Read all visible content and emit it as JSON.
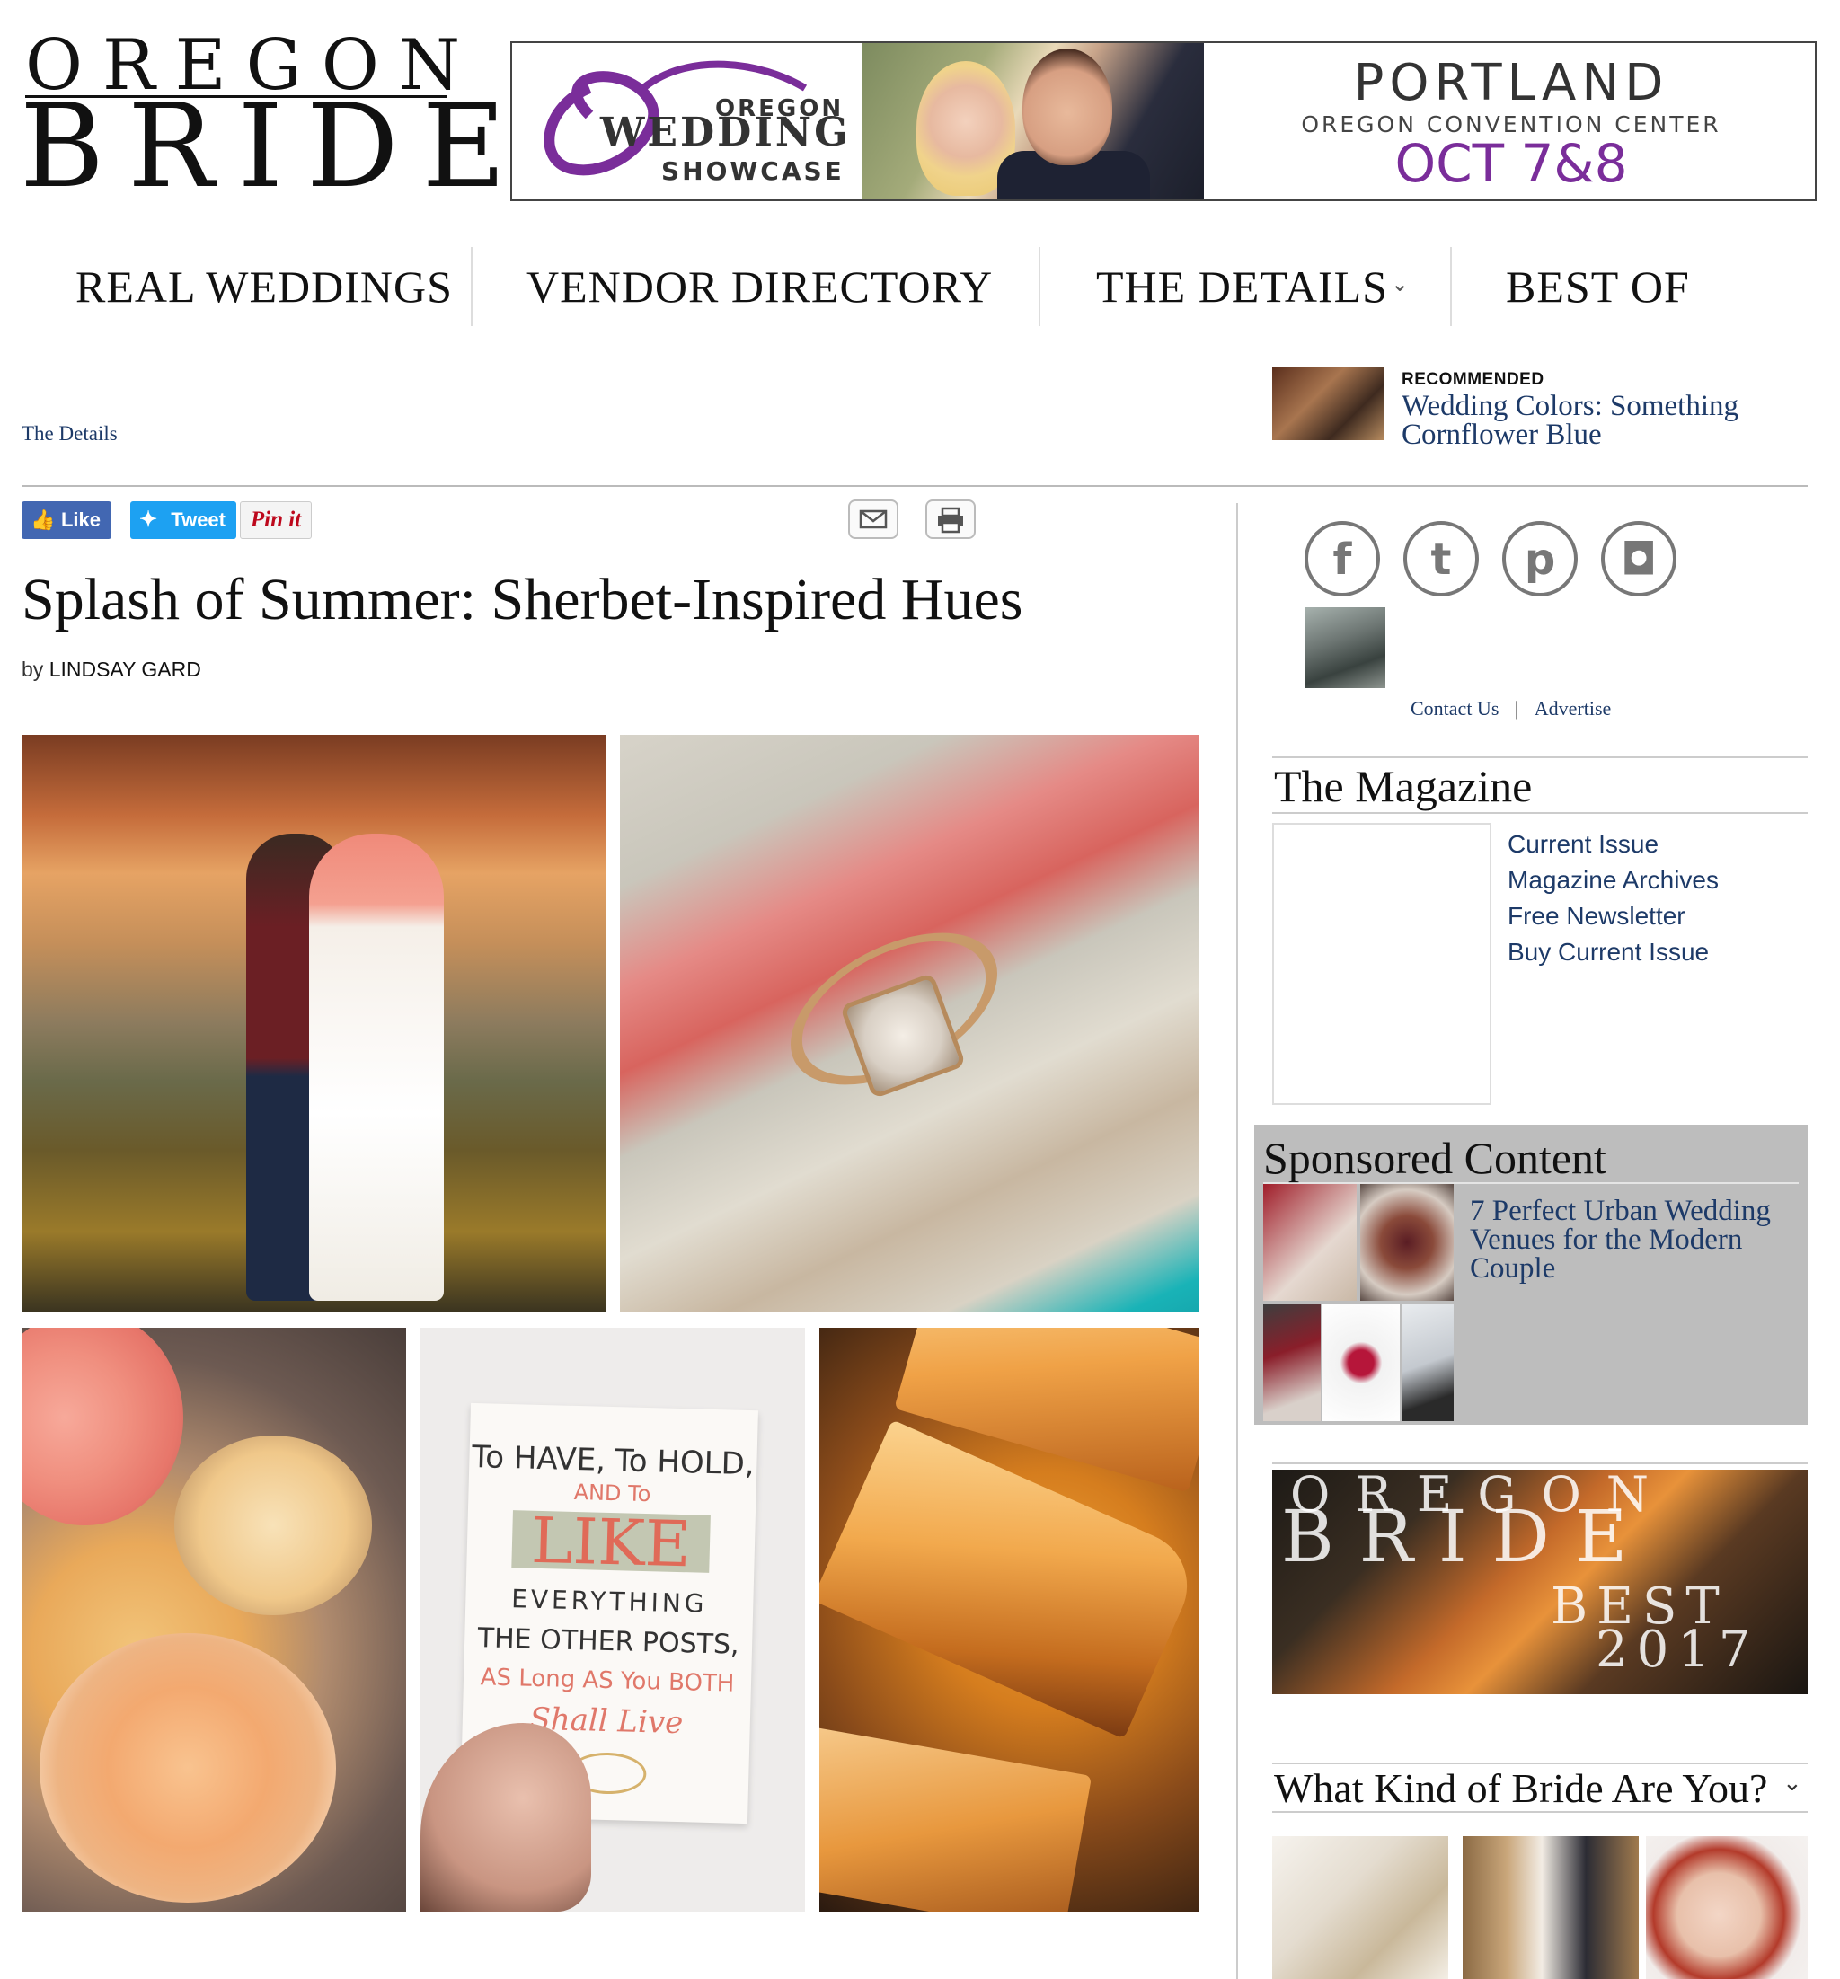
{
  "brand": {
    "logo_top": "OREGON",
    "logo_bottom": "BRIDE"
  },
  "banner": {
    "showcase_line1": "OREGON",
    "showcase_line2": "WEDDING",
    "showcase_line3": "SHOWCASE",
    "city": "PORTLAND",
    "venue": "OREGON CONVENTION CENTER",
    "date": "OCT 7&8",
    "accent": "#7a2d9a"
  },
  "nav": {
    "items": [
      {
        "label": "REAL WEDDINGS"
      },
      {
        "label": "VENDOR DIRECTORY"
      },
      {
        "label": "THE DETAILS",
        "dropdown_icon": "chevron-down-icon"
      },
      {
        "label": "BEST OF"
      }
    ]
  },
  "breadcrumb": {
    "label": "The Details"
  },
  "recommended": {
    "label": "RECOMMENDED",
    "title": "Wedding Colors: Something Cornflower Blue"
  },
  "share": {
    "like": "Like",
    "tweet": "Tweet",
    "pin": "Pin it",
    "email_icon": "envelope-icon",
    "print_icon": "printer-icon"
  },
  "article": {
    "title": "Splash of Summer: Sherbet-Inspired Hues",
    "byline_prefix": "by",
    "author": "LINDSAY GARD",
    "card_lines": [
      "To HAVE, To HOLD,",
      "AND To",
      "LIKE",
      "EVERYTHING",
      "THE OTHER POSTS,",
      "AS Long AS You BOTH",
      "Shall Live"
    ]
  },
  "sidebar": {
    "social": [
      {
        "name": "facebook-icon",
        "glyph": "f"
      },
      {
        "name": "twitter-icon",
        "glyph": "t"
      },
      {
        "name": "pinterest-icon",
        "glyph": "p"
      },
      {
        "name": "instagram-icon",
        "glyph": "◘"
      }
    ],
    "contact": "Contact Us",
    "separator": "|",
    "advertise": "Advertise",
    "magazine": {
      "title": "The Magazine",
      "links": [
        "Current Issue",
        "Magazine Archives",
        "Free Newsletter",
        "Buy Current Issue"
      ]
    },
    "sponsored": {
      "title": "Sponsored Content",
      "article": "7 Perfect Urban Wedding Venues for the Modern Couple"
    },
    "cover": {
      "line1": "OREGON",
      "line2": "BRIDE",
      "line3": "BEST",
      "line4": "2017"
    },
    "quiz": {
      "title": "What Kind of Bride Are You?"
    }
  },
  "colors": {
    "link": "#1d3a68",
    "facebook": "#4267b2",
    "twitter": "#1da1f2",
    "pinterest": "#bd081c",
    "sponsored_bg": "#bdbdbd"
  }
}
